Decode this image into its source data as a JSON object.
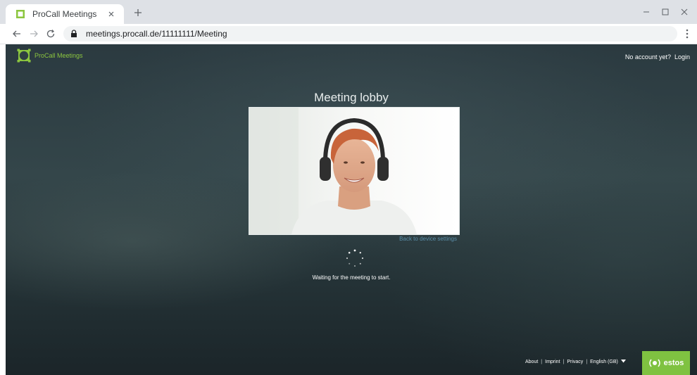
{
  "browser": {
    "tab_title": "ProCall Meetings",
    "url": "meetings.procall.de/11111111/Meeting"
  },
  "app": {
    "logo_text": "ProCall Meetings",
    "no_account": "No account yet?",
    "login": "Login"
  },
  "lobby": {
    "title": "Meeting lobby",
    "back_link": "Back to device settings",
    "status": "Waiting for the meeting to start."
  },
  "footer": {
    "about": "About",
    "imprint": "Imprint",
    "privacy": "Privacy",
    "language": "English (GB)",
    "separator": "|",
    "brand": "estos"
  },
  "colors": {
    "brand_green": "#8cc63f",
    "estos_green": "#7fc241",
    "link_blue": "#5a8ea8"
  },
  "icons": [
    "procall-logo-icon",
    "close-icon",
    "plus-icon",
    "minimize-icon",
    "maximize-icon",
    "back-arrow-icon",
    "forward-arrow-icon",
    "reload-icon",
    "lock-icon",
    "more-vert-icon",
    "loading-spinner-icon",
    "caret-down-icon",
    "estos-logo-icon"
  ]
}
